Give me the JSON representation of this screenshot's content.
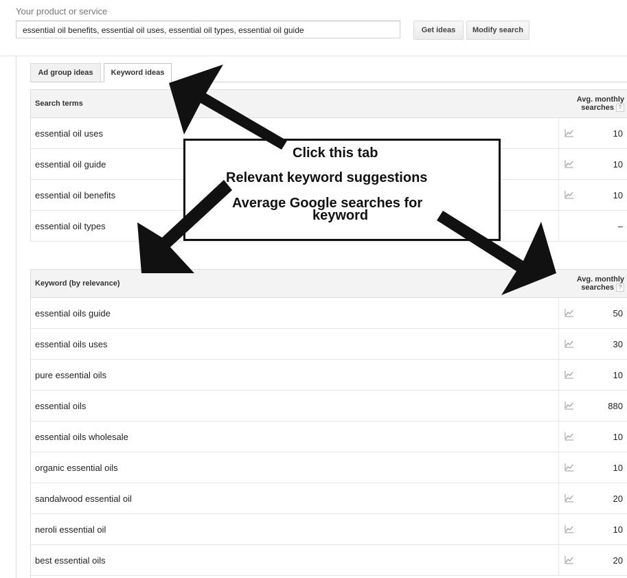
{
  "product": {
    "label": "Your product or service",
    "value": "essential oil benefits, essential oil uses, essential oil types, essential oil guide"
  },
  "buttons": {
    "get_ideas": "Get ideas",
    "modify_search": "Modify search"
  },
  "tabs": [
    {
      "label": "Ad group ideas",
      "active": false
    },
    {
      "label": "Keyword ideas",
      "active": true
    }
  ],
  "search_terms": {
    "header_label": "Search terms",
    "avg_header": "Avg. monthly searches",
    "help": "?",
    "rows": [
      {
        "keyword": "essential oil uses",
        "searches": "10"
      },
      {
        "keyword": "essential oil guide",
        "searches": "10"
      },
      {
        "keyword": "essential oil benefits",
        "searches": "10"
      },
      {
        "keyword": "essential oil types",
        "searches": "–"
      }
    ]
  },
  "keyword_ideas": {
    "header_label": "Keyword (by relevance)",
    "avg_header": "Avg. monthly searches",
    "help": "?",
    "rows": [
      {
        "keyword": "essential oils guide",
        "searches": "50"
      },
      {
        "keyword": "essential oils uses",
        "searches": "30"
      },
      {
        "keyword": "pure essential oils",
        "searches": "10"
      },
      {
        "keyword": "essential oils",
        "searches": "880"
      },
      {
        "keyword": "essential oils wholesale",
        "searches": "10"
      },
      {
        "keyword": "organic essential oils",
        "searches": "10"
      },
      {
        "keyword": "sandalwood essential oil",
        "searches": "20"
      },
      {
        "keyword": "neroli essential oil",
        "searches": "10"
      },
      {
        "keyword": "best essential oils",
        "searches": "20"
      }
    ]
  },
  "annotation": {
    "line1": "Click this tab",
    "line2": "Relevant keyword suggestions",
    "line3": "Average Google searches for",
    "line4": "keyword"
  },
  "icons": {
    "trend": "trend-chart-icon",
    "help": "help-question-icon",
    "arrow": "annotation-arrow"
  },
  "colors": {
    "header_bg": "#f3f3f3",
    "border": "#dcdcdc",
    "annotation": "#111111"
  }
}
